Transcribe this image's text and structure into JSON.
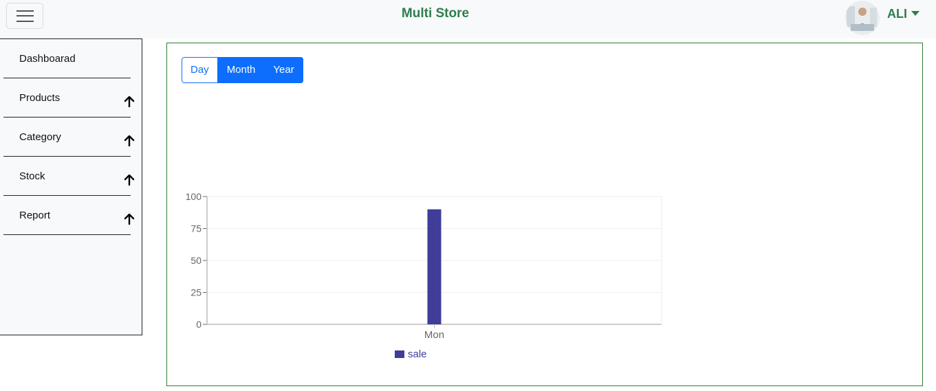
{
  "header": {
    "brand": "Multi Store",
    "user_name": "ALI",
    "menu_icon": "hamburger-icon",
    "brand_color": "#2e7d4f"
  },
  "sidebar": {
    "items": [
      {
        "label": "Dashboarad",
        "icon": null
      },
      {
        "label": "Products",
        "icon": "arrow-up-icon"
      },
      {
        "label": "Category",
        "icon": "arrow-up-icon"
      },
      {
        "label": "Stock",
        "icon": "arrow-up-icon"
      },
      {
        "label": "Report",
        "icon": "arrow-up-icon"
      }
    ]
  },
  "period_toggle": {
    "options": [
      "Day",
      "Month",
      "Year"
    ],
    "selected": "Day",
    "accent": "#0d6efd"
  },
  "chart_data": {
    "type": "bar",
    "categories": [
      "Mon"
    ],
    "series": [
      {
        "name": "sale",
        "values": [
          90
        ],
        "color": "#3f3d99"
      }
    ],
    "ylim": [
      0,
      100
    ],
    "yticks": [
      "0",
      "25",
      "50",
      "75",
      "100"
    ],
    "grid": true,
    "legend": "bottom"
  }
}
